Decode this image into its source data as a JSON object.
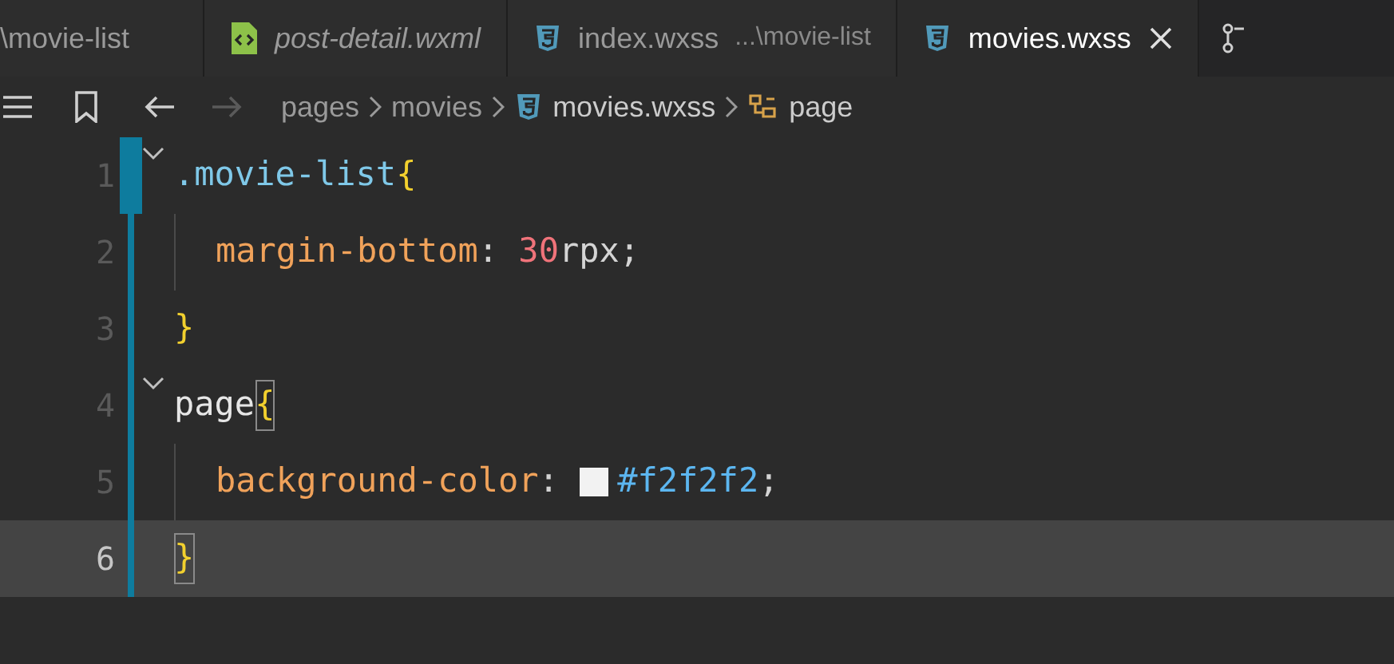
{
  "tabs": [
    {
      "label": "\\movie-list",
      "kind": "plain",
      "italic": false,
      "selected": false
    },
    {
      "label": "post-detail.wxml",
      "kind": "markup",
      "italic": true,
      "selected": false
    },
    {
      "label": "index.wxss",
      "description": "...\\movie-list",
      "kind": "style",
      "italic": false,
      "selected": false
    },
    {
      "label": "movies.wxss",
      "kind": "style",
      "italic": false,
      "selected": true,
      "closable": true
    }
  ],
  "breadcrumbs": [
    {
      "label": "pages",
      "kind": "folder"
    },
    {
      "label": "movies",
      "kind": "folder"
    },
    {
      "label": "movies.wxss",
      "kind": "style"
    },
    {
      "label": "page",
      "kind": "symbol"
    }
  ],
  "lines": [
    {
      "number": "1",
      "modified": true,
      "foldable": true,
      "indented": false,
      "selected": false,
      "tokens": [
        {
          "kind": "selector",
          "text": ".movie-list"
        },
        {
          "kind": "brace",
          "text": "{",
          "matched": false
        }
      ]
    },
    {
      "number": "2",
      "modified": false,
      "foldable": false,
      "indented": true,
      "selected": false,
      "tokens": [
        {
          "kind": "property",
          "text": "margin-bottom"
        },
        {
          "kind": "punct",
          "text": ": "
        },
        {
          "kind": "number",
          "text": "30"
        },
        {
          "kind": "unit",
          "text": "rpx"
        },
        {
          "kind": "punct",
          "text": ";"
        }
      ]
    },
    {
      "number": "3",
      "modified": false,
      "foldable": false,
      "indented": false,
      "selected": false,
      "tokens": [
        {
          "kind": "brace",
          "text": "}",
          "matched": false
        }
      ]
    },
    {
      "number": "4",
      "modified": false,
      "foldable": true,
      "indented": false,
      "selected": false,
      "tokens": [
        {
          "kind": "tag",
          "text": "page"
        },
        {
          "kind": "brace",
          "text": "{",
          "matched": true
        }
      ]
    },
    {
      "number": "5",
      "modified": false,
      "foldable": false,
      "indented": true,
      "selected": false,
      "tokens": [
        {
          "kind": "property",
          "text": "background-color"
        },
        {
          "kind": "punct",
          "text": ": "
        },
        {
          "kind": "swatch",
          "color": "#f2f2f2"
        },
        {
          "kind": "value",
          "text": "#f2f2f2"
        },
        {
          "kind": "punct",
          "text": ";"
        }
      ]
    },
    {
      "number": "6",
      "modified": false,
      "foldable": false,
      "indented": false,
      "selected": true,
      "tokens": [
        {
          "kind": "brace",
          "text": "}",
          "matched": true
        }
      ]
    }
  ]
}
